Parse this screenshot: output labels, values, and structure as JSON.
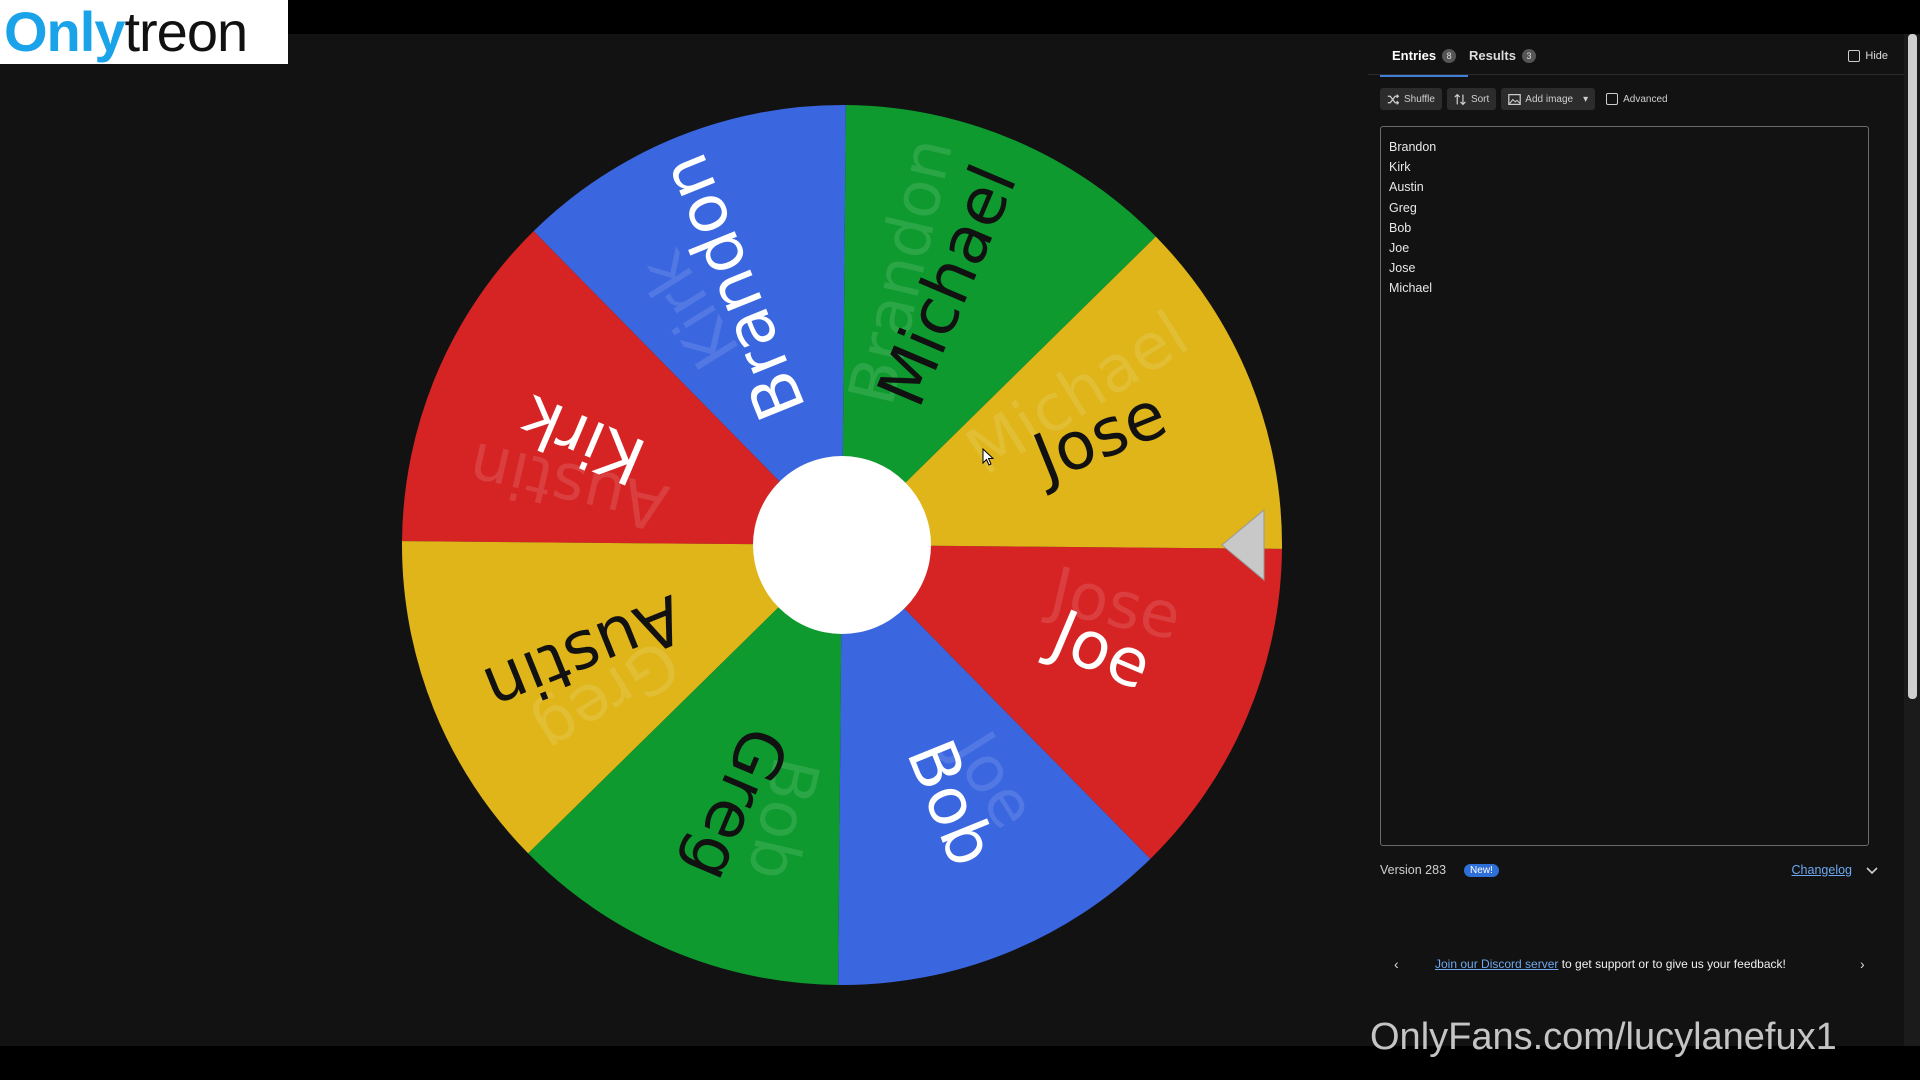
{
  "logo": {
    "part1": "Only",
    "part2": "treon"
  },
  "wheel": {
    "colors": {
      "blue": "#3a66e0",
      "green": "#0e9a2e",
      "yellow": "#dfb51a",
      "red": "#d62424",
      "hub": "#ffffff",
      "pointer": "#cccccc"
    },
    "segments": [
      {
        "label": "Michael",
        "color": "#0e9a2e",
        "ghost": "Brandon"
      },
      {
        "label": "Brandon",
        "color": "#3a66e0",
        "ghost": "Kirk"
      },
      {
        "label": "Kirk",
        "color": "#d62424",
        "ghost": "Austin"
      },
      {
        "label": "Austin",
        "color": "#dfb51a",
        "ghost": "Greg"
      },
      {
        "label": "Greg",
        "color": "#0e9a2e",
        "ghost": "Bob"
      },
      {
        "label": "Bob",
        "color": "#3a66e0",
        "ghost": "Joe"
      },
      {
        "label": "Joe",
        "color": "#d62424",
        "ghost": "Jose"
      },
      {
        "label": "Jose",
        "color": "#dfb51a",
        "ghost": "Michael"
      }
    ]
  },
  "panel": {
    "tabs": [
      {
        "label": "Entries",
        "count": "8"
      },
      {
        "label": "Results",
        "count": "3"
      }
    ],
    "hide_label": "Hide",
    "toolbar": {
      "shuffle": "Shuffle",
      "sort": "Sort",
      "add_image": "Add image",
      "advanced": "Advanced"
    },
    "entries": [
      "Brandon",
      "Kirk",
      "Austin",
      "Greg",
      "Bob",
      "Joe",
      "Jose",
      "Michael"
    ],
    "version": "Version 283",
    "new_badge": "New!",
    "changelog": "Changelog",
    "discord": {
      "link": "Join our Discord server",
      "rest": " to get support or to give us your feedback!"
    }
  },
  "watermark": "OnlyFans.com/lucylanefux1"
}
